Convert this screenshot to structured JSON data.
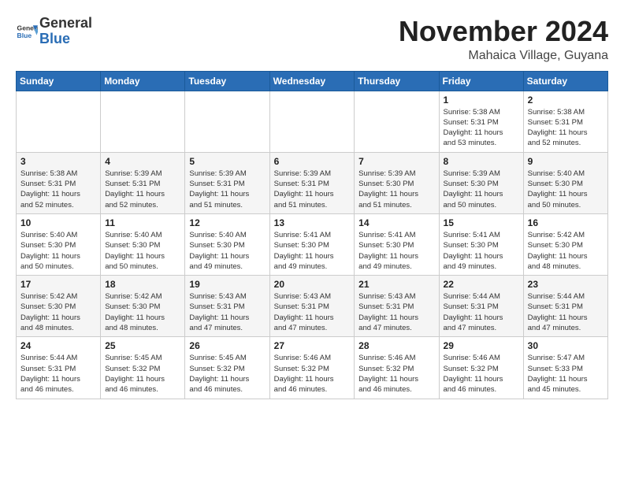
{
  "logo": {
    "general": "General",
    "blue": "Blue"
  },
  "header": {
    "month": "November 2024",
    "location": "Mahaica Village, Guyana"
  },
  "days_of_week": [
    "Sunday",
    "Monday",
    "Tuesday",
    "Wednesday",
    "Thursday",
    "Friday",
    "Saturday"
  ],
  "weeks": [
    [
      {
        "day": "",
        "info": ""
      },
      {
        "day": "",
        "info": ""
      },
      {
        "day": "",
        "info": ""
      },
      {
        "day": "",
        "info": ""
      },
      {
        "day": "",
        "info": ""
      },
      {
        "day": "1",
        "info": "Sunrise: 5:38 AM\nSunset: 5:31 PM\nDaylight: 11 hours\nand 53 minutes."
      },
      {
        "day": "2",
        "info": "Sunrise: 5:38 AM\nSunset: 5:31 PM\nDaylight: 11 hours\nand 52 minutes."
      }
    ],
    [
      {
        "day": "3",
        "info": "Sunrise: 5:38 AM\nSunset: 5:31 PM\nDaylight: 11 hours\nand 52 minutes."
      },
      {
        "day": "4",
        "info": "Sunrise: 5:39 AM\nSunset: 5:31 PM\nDaylight: 11 hours\nand 52 minutes."
      },
      {
        "day": "5",
        "info": "Sunrise: 5:39 AM\nSunset: 5:31 PM\nDaylight: 11 hours\nand 51 minutes."
      },
      {
        "day": "6",
        "info": "Sunrise: 5:39 AM\nSunset: 5:31 PM\nDaylight: 11 hours\nand 51 minutes."
      },
      {
        "day": "7",
        "info": "Sunrise: 5:39 AM\nSunset: 5:30 PM\nDaylight: 11 hours\nand 51 minutes."
      },
      {
        "day": "8",
        "info": "Sunrise: 5:39 AM\nSunset: 5:30 PM\nDaylight: 11 hours\nand 50 minutes."
      },
      {
        "day": "9",
        "info": "Sunrise: 5:40 AM\nSunset: 5:30 PM\nDaylight: 11 hours\nand 50 minutes."
      }
    ],
    [
      {
        "day": "10",
        "info": "Sunrise: 5:40 AM\nSunset: 5:30 PM\nDaylight: 11 hours\nand 50 minutes."
      },
      {
        "day": "11",
        "info": "Sunrise: 5:40 AM\nSunset: 5:30 PM\nDaylight: 11 hours\nand 50 minutes."
      },
      {
        "day": "12",
        "info": "Sunrise: 5:40 AM\nSunset: 5:30 PM\nDaylight: 11 hours\nand 49 minutes."
      },
      {
        "day": "13",
        "info": "Sunrise: 5:41 AM\nSunset: 5:30 PM\nDaylight: 11 hours\nand 49 minutes."
      },
      {
        "day": "14",
        "info": "Sunrise: 5:41 AM\nSunset: 5:30 PM\nDaylight: 11 hours\nand 49 minutes."
      },
      {
        "day": "15",
        "info": "Sunrise: 5:41 AM\nSunset: 5:30 PM\nDaylight: 11 hours\nand 49 minutes."
      },
      {
        "day": "16",
        "info": "Sunrise: 5:42 AM\nSunset: 5:30 PM\nDaylight: 11 hours\nand 48 minutes."
      }
    ],
    [
      {
        "day": "17",
        "info": "Sunrise: 5:42 AM\nSunset: 5:30 PM\nDaylight: 11 hours\nand 48 minutes."
      },
      {
        "day": "18",
        "info": "Sunrise: 5:42 AM\nSunset: 5:30 PM\nDaylight: 11 hours\nand 48 minutes."
      },
      {
        "day": "19",
        "info": "Sunrise: 5:43 AM\nSunset: 5:31 PM\nDaylight: 11 hours\nand 47 minutes."
      },
      {
        "day": "20",
        "info": "Sunrise: 5:43 AM\nSunset: 5:31 PM\nDaylight: 11 hours\nand 47 minutes."
      },
      {
        "day": "21",
        "info": "Sunrise: 5:43 AM\nSunset: 5:31 PM\nDaylight: 11 hours\nand 47 minutes."
      },
      {
        "day": "22",
        "info": "Sunrise: 5:44 AM\nSunset: 5:31 PM\nDaylight: 11 hours\nand 47 minutes."
      },
      {
        "day": "23",
        "info": "Sunrise: 5:44 AM\nSunset: 5:31 PM\nDaylight: 11 hours\nand 47 minutes."
      }
    ],
    [
      {
        "day": "24",
        "info": "Sunrise: 5:44 AM\nSunset: 5:31 PM\nDaylight: 11 hours\nand 46 minutes."
      },
      {
        "day": "25",
        "info": "Sunrise: 5:45 AM\nSunset: 5:32 PM\nDaylight: 11 hours\nand 46 minutes."
      },
      {
        "day": "26",
        "info": "Sunrise: 5:45 AM\nSunset: 5:32 PM\nDaylight: 11 hours\nand 46 minutes."
      },
      {
        "day": "27",
        "info": "Sunrise: 5:46 AM\nSunset: 5:32 PM\nDaylight: 11 hours\nand 46 minutes."
      },
      {
        "day": "28",
        "info": "Sunrise: 5:46 AM\nSunset: 5:32 PM\nDaylight: 11 hours\nand 46 minutes."
      },
      {
        "day": "29",
        "info": "Sunrise: 5:46 AM\nSunset: 5:32 PM\nDaylight: 11 hours\nand 46 minutes."
      },
      {
        "day": "30",
        "info": "Sunrise: 5:47 AM\nSunset: 5:33 PM\nDaylight: 11 hours\nand 45 minutes."
      }
    ]
  ]
}
